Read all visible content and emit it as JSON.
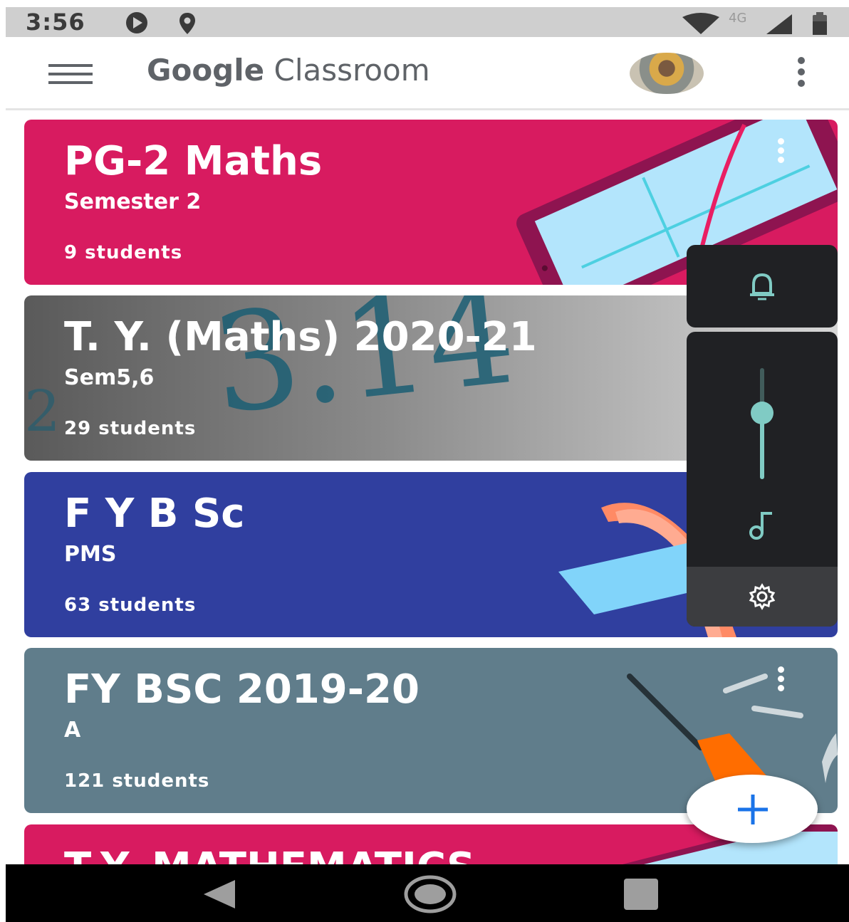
{
  "status_bar": {
    "time": "3:56",
    "network": "4G",
    "icons": [
      "play-icon",
      "location-icon",
      "wifi-icon",
      "cell-signal-icon",
      "battery-icon"
    ]
  },
  "app_bar": {
    "title_brand": "Google",
    "title_product": "Classroom",
    "icons": [
      "menu-icon",
      "avatar",
      "more-vert-icon"
    ]
  },
  "classes": [
    {
      "title": "PG-2 Maths",
      "section": "Semester 2",
      "students": "9 students",
      "color": "#d81b60"
    },
    {
      "title": "T. Y. (Maths) 2020-21",
      "section": "Sem5,6",
      "students": "29 students",
      "color": "#6d6d6d"
    },
    {
      "title": "F Y B Sc",
      "section": "PMS",
      "students": "63 students",
      "color": "#303f9f"
    },
    {
      "title": "FY BSC 2019-20",
      "section": "A",
      "students": "121 students",
      "color": "#607d8b"
    },
    {
      "title": "T.Y. MATHEMATICS",
      "section": "",
      "students": "",
      "color": "#d81b60"
    }
  ],
  "volume_panel": {
    "icons": [
      "bell-icon",
      "music-note-icon",
      "settings-gear-icon"
    ],
    "media_volume_level": 0.6,
    "accent": "#80cbc4"
  },
  "fab": {
    "icon": "plus-icon",
    "accent": "#1a73e8"
  },
  "nav_bar": {
    "icons": [
      "back-icon",
      "home-icon",
      "recents-icon"
    ]
  }
}
